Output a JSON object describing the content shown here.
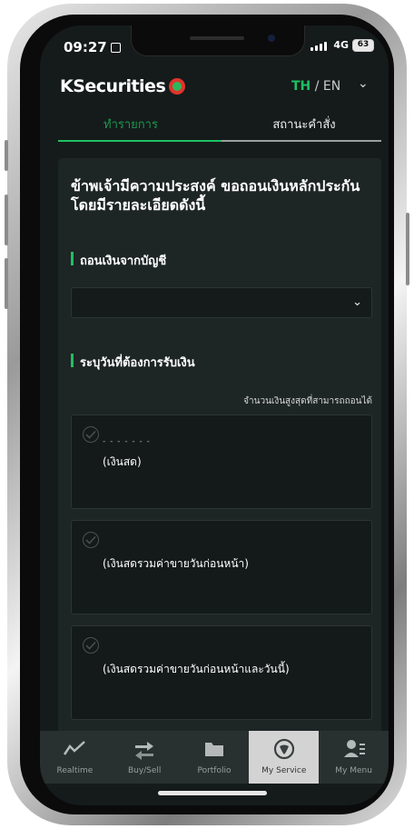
{
  "colors": {
    "accent": "#1fbf63",
    "background": "#151b1b",
    "card": "#1e2525",
    "nav_active": "#d3d3d3"
  },
  "status_bar": {
    "time": "09:27",
    "network": "4G",
    "battery": "63"
  },
  "header": {
    "brand": "KSecurities",
    "lang_active": "TH",
    "lang_sep": " / ",
    "lang_other": "EN",
    "chevron": "⌄"
  },
  "tabs": [
    {
      "label": "ทำรายการ",
      "active": true
    },
    {
      "label": "สถานะคำสั่ง",
      "active": false
    }
  ],
  "form": {
    "heading": "ข้าพเจ้ามีความประสงค์ ขอถอนเงินหลักประกัน โดยมีรายละเอียดดังนี้",
    "account_section": "ถอนเงินจากบัญชี",
    "account_value": "",
    "date_section": "ระบุวันที่ต้องการรับเงิน",
    "max_label": "จำนวนเงินสูงสุดที่สามารถถอนได้",
    "options": [
      {
        "label": "(เงินสด)",
        "amount": "- - -  - - - -"
      },
      {
        "label": "(เงินสดรวมค่าขายวันก่อนหน้า)",
        "amount": ""
      },
      {
        "label": "(เงินสดรวมค่าขายวันก่อนหน้าและวันนี้)",
        "amount": ""
      }
    ]
  },
  "nav": [
    {
      "label": "Realtime",
      "icon": "chart-line-icon",
      "active": false
    },
    {
      "label": "Buy/Sell",
      "icon": "buy-sell-arrows-icon",
      "active": false
    },
    {
      "label": "Portfolio",
      "icon": "folder-icon",
      "active": false
    },
    {
      "label": "My Service",
      "icon": "my-service-leaf-icon",
      "active": true
    },
    {
      "label": "My Menu",
      "icon": "user-menu-icon",
      "active": false
    }
  ]
}
